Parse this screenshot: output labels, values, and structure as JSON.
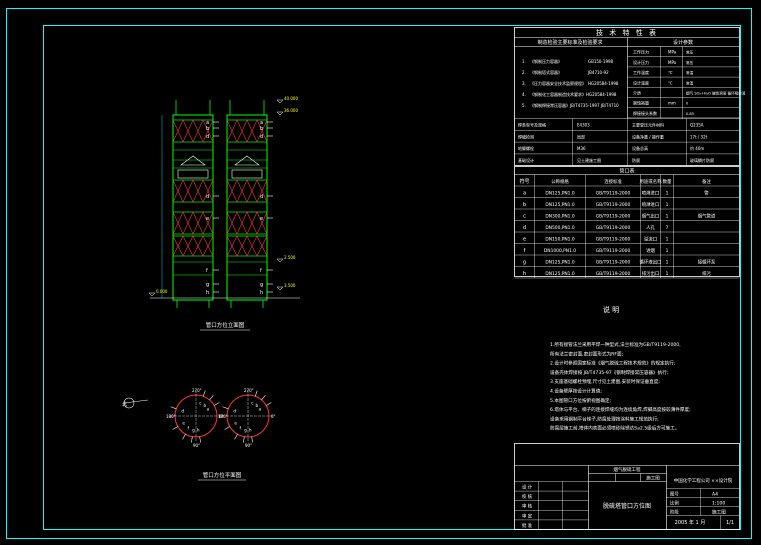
{
  "colors": {
    "background": "#000000",
    "frame": "#00ffff",
    "structure": "#00ff00",
    "bracing": "#ff3333",
    "text": "#ffffff",
    "dims": "#00ffff",
    "labels": "#ffff00"
  },
  "tech_table": {
    "title": "技 术 特 性 表",
    "left_header": "制造检验主要标准及检验要求",
    "right_header": "设计参数",
    "standards": [
      {
        "n": "1.",
        "t": "《钢制压力容器》",
        "code": "GB150-1998"
      },
      {
        "n": "2.",
        "t": "《钢制塔式容器》",
        "code": "JB4710-92"
      },
      {
        "n": "3.",
        "t": "《压力容器安全技术监察规程》",
        "code": "HG20584-1998"
      },
      {
        "n": "4.",
        "t": "《钢制化工容器制造技术要求》HG20584-1998",
        "code": ""
      },
      {
        "n": "5.",
        "t": "《钢制焊接常压容器》JB/T4735-1997 JB/T4710",
        "code": ""
      }
    ],
    "params": [
      {
        "k": "工作压力",
        "u": "MPa",
        "v": "常压"
      },
      {
        "k": "设计压力",
        "u": "MPa",
        "v": "常压"
      },
      {
        "k": "工作温度",
        "u": "℃",
        "v": "常温"
      },
      {
        "k": "设计温度",
        "u": "℃",
        "v": "常温"
      },
      {
        "k": "介质",
        "u": "",
        "v": "烟气 SO₂+H₂O 碱性溶液 循环吸收液"
      },
      {
        "k": "腐蚀裕量",
        "u": "mm",
        "v": "0"
      },
      {
        "k": "焊接接头系数",
        "u": "",
        "v": "0.85"
      }
    ],
    "lower_rows": [
      [
        "焊条型号及规格",
        "E4303",
        "主要受压元件材料",
        "Q235A"
      ],
      [
        "焊缝检测",
        "局部",
        "设备净重 / 操作重",
        "17t / 32t"
      ],
      [
        "地脚螺栓",
        "M36",
        "设备总高",
        "约 40m"
      ],
      [
        "基础设计",
        "见土建施工图",
        "防腐",
        "玻璃鳞片防腐"
      ]
    ]
  },
  "nozzle_table": {
    "title": "管口表",
    "headers": [
      "符号",
      "公称规格",
      "连接标准",
      "用途或名称",
      "数量",
      "备注"
    ],
    "rows": [
      [
        "a",
        "DN125,PN1.0",
        "GB/T9119-2000",
        "喷淋进口",
        "1",
        "管"
      ],
      [
        "b",
        "DN125,PN1.0",
        "GB/T9119-2000",
        "喷淋进口",
        "1",
        ""
      ],
      [
        "c",
        "DN300,PN1.0",
        "GB/T9119-2000",
        "烟气出口",
        "1",
        "烟气管道"
      ],
      [
        "d",
        "DN500,PN1.0",
        "GB/T9119-2000",
        "人孔",
        "7",
        ""
      ],
      [
        "e",
        "DN150,PN1.0",
        "GB/T9119-2000",
        "溢流口",
        "1",
        ""
      ],
      [
        "f",
        "DN1000,PN1.0",
        "GB/T9119-2000",
        "进烟",
        "1",
        ""
      ],
      [
        "g",
        "DN125,PN1.0",
        "GB/T9119-2000",
        "循环液出口",
        "1",
        "接循环泵"
      ],
      [
        "h",
        "DN125,PN1.0",
        "GB/T9119-2000",
        "排污出口",
        "1",
        "排污"
      ]
    ]
  },
  "notes": {
    "title": "说  明",
    "lines": [
      "1.所有接管法兰采用平焊一种型式,法兰标准为GB/T9119-2000,",
      "  所有法兰密封面,密封面形式为RF面;",
      "2.设计时参照国家标准《烟气脱硫工程技术规范》的规定执行;",
      "  设备壳体焊接按 JB/T4735-97《钢制焊接常压容器》执行;",
      "3.支座基础螺栓预埋,尺寸见土建图,安装时保证垂直度;",
      "4.设备壁厚按设计计算值;",
      "5.本图管口方位按俯视图确定;",
      "6.塔体与平台、梯子的连接焊缝均为连续角焊,焊脚高度按较薄件厚度;",
      "  设备采用钢制平台梯子,防腐处理按涂料施工规范执行;",
      "  防腐层施工前,塔体内表面必须喷砂除锈达Sa2.5级后方可施工。"
    ]
  },
  "drawing": {
    "elevation_title": "管口方位立面图",
    "plan_title": "管口方位平面图",
    "elev_marks": [
      "40.000",
      "36.000",
      "0.000",
      "2.500",
      "3.500"
    ],
    "angles": [
      "270°",
      "180°",
      "90°",
      "0°"
    ],
    "nozzle_letters": [
      "a",
      "b",
      "c",
      "d",
      "e",
      "f",
      "g",
      "h"
    ],
    "north": "北"
  },
  "title_block": {
    "title_main": "脱硫塔管口方位图",
    "company": "中国化学工程公司 ××设计院",
    "project": "烟气脱硫工程",
    "design_stage": "施工图",
    "sign_rows": [
      "设 计",
      "校 核",
      "审 核",
      "审 定",
      "批 准"
    ],
    "info_rows": [
      [
        "图号",
        "A4"
      ],
      [
        "比例",
        "1:100"
      ],
      [
        "阶段",
        "施工图"
      ]
    ],
    "scale_label": "1:100",
    "sheet": "1/1",
    "date": "2005 年 1 月"
  }
}
